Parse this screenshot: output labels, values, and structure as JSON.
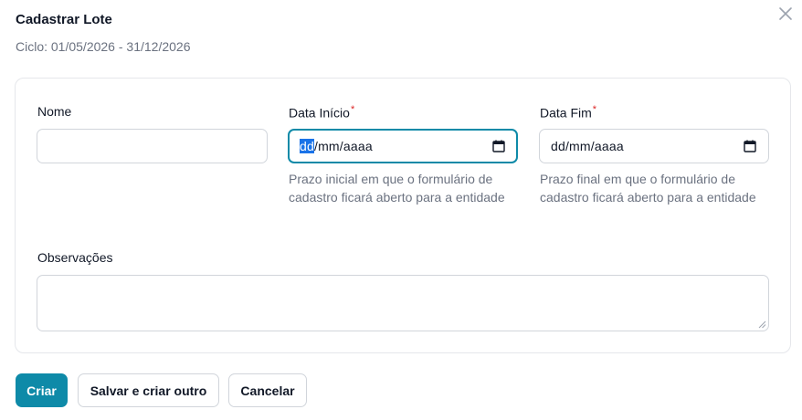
{
  "modal": {
    "title": "Cadastrar Lote",
    "subtitle": "Ciclo: 01/05/2026 - 31/12/2026"
  },
  "form": {
    "nome": {
      "label": "Nome",
      "value": ""
    },
    "data_inicio": {
      "label": "Data Início",
      "required_mark": "*",
      "segment_day": "dd",
      "segment_rest": "/mm/aaaa",
      "help": "Prazo inicial em que o formulário de cadastro ficará aberto para a entidade"
    },
    "data_fim": {
      "label": "Data Fim",
      "required_mark": "*",
      "placeholder": "dd/mm/aaaa",
      "help": "Prazo final em que o formulário de cadastro ficará aberto para a entidade"
    },
    "observacoes": {
      "label": "Observações",
      "value": ""
    }
  },
  "actions": {
    "create": "Criar",
    "save_and_new": "Salvar e criar outro",
    "cancel": "Cancelar"
  },
  "colors": {
    "primary": "#0e8aa8",
    "required": "#dc2626",
    "muted_text": "#6b7280",
    "border": "#d1d5db"
  },
  "icons": {
    "close": "close-icon",
    "calendar": "calendar-icon",
    "resize": "resize-grip-icon"
  }
}
